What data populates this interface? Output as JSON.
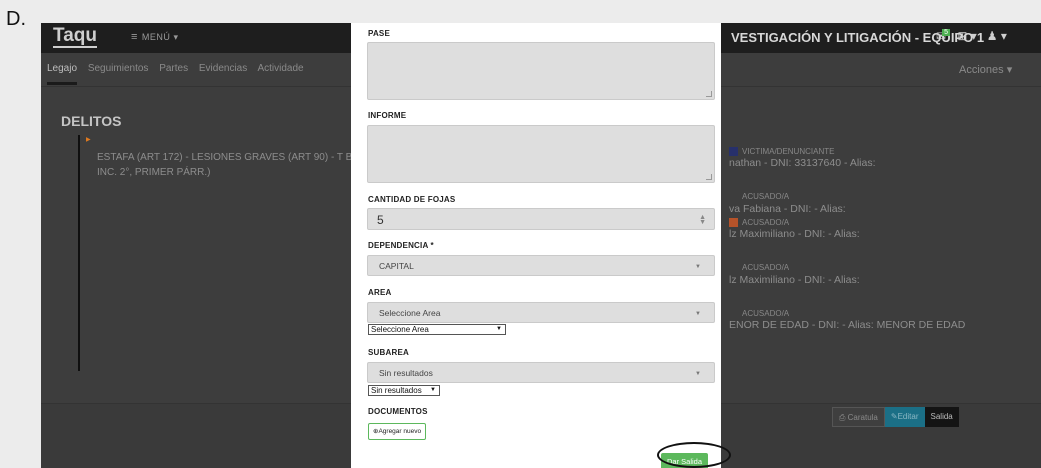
{
  "label_letter": "D.",
  "app": {
    "logo": "Taqu",
    "menu_label": "MENÚ",
    "header_title": "VESTIGACIÓN Y LITIGACIÓN - EQUIPO 1",
    "notification_count": "5",
    "tabs": [
      "Legajo",
      "Seguimientos",
      "Partes",
      "Evidencias",
      "Actividade"
    ],
    "actions_label": "Acciones",
    "delitos_heading": "DELITOS",
    "delito_text": "ESTAFA (ART 172) - LESIONES GRAVES (ART 90) - T BIS, INC. 2°, PRIMER PÁRR.)",
    "parties": [
      {
        "role": "VICTIMA/DENUNCIANTE",
        "name": "nathan - DNI: 33137640 - Alias:",
        "tag_color": "#27306b"
      },
      {
        "role": "ACUSADO/A",
        "name": "va Fabiana - DNI: - Alias:",
        "tag_color": ""
      },
      {
        "role": "ACUSADO/A",
        "name": "lz Maximiliano - DNI: - Alias:",
        "tag_color": "#b5532a"
      },
      {
        "role": "ACUSADO/A",
        "name": "lz Maximiliano - DNI: - Alias:",
        "tag_color": ""
      },
      {
        "role": "ACUSADO/A",
        "name": "ENOR DE EDAD - DNI: - Alias: MENOR DE EDAD",
        "tag_color": ""
      }
    ],
    "footer_buttons": {
      "caratula": "Caratula",
      "editar": "Editar",
      "salida": "Salida"
    }
  },
  "modal": {
    "pase_label": "PASE",
    "informe_label": "INFORME",
    "fojas_label": "CANTIDAD DE FOJAS",
    "fojas_value": "5",
    "dependencia_label": "DEPENDENCIA *",
    "dependencia_value": "CAPITAL",
    "area_label": "AREA",
    "area_value": "Seleccione Area",
    "area_native_value": "Seleccione Area",
    "subarea_label": "SUBAREA",
    "subarea_value": "Sin resultados",
    "subarea_native_value": "Sin resultados",
    "documentos_label": "DOCUMENTOS",
    "add_new_label": "Agregar nuevo",
    "submit_label": "Dar Salida"
  }
}
